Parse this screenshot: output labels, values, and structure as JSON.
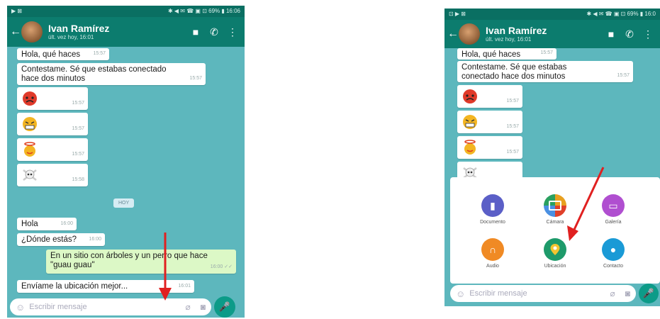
{
  "colors": {
    "header": "#0c7c6e",
    "chat_bg": "#5db7bd",
    "outgoing": "#dcf8c6",
    "arrow": "#e02020"
  },
  "phone1": {
    "status": {
      "left": "▶ ⊠",
      "right": "✱ ◀ ✉ ☎ ▣ ⊡ 69% ▮ 16:06"
    },
    "contact": {
      "name": "Ivan Ramírez",
      "status": "últ. vez hoy, 16:01"
    },
    "messages": [
      {
        "text": "Hola, qué haces",
        "time": "15:57"
      },
      {
        "text": "Contestame. Sé que estabas conectado hace dos minutos",
        "time": "15:57"
      },
      {
        "emoji": "angry-face",
        "time": "15:57"
      },
      {
        "emoji": "grimacing-face",
        "time": "15:57"
      },
      {
        "emoji": "angel-face",
        "time": "15:57"
      },
      {
        "emoji": "skull-crossbones",
        "time": "15:58"
      }
    ],
    "date_chip": "HOY",
    "messages2": [
      {
        "text": "Hola",
        "time": "16:00"
      },
      {
        "text": "¿Dónde estás?",
        "time": "16:00"
      },
      {
        "text": "En un sitio con árboles y un perro que hace \"guau guau\"",
        "time": "16:00 ✓✓",
        "out": true
      },
      {
        "text": "Envíame la ubicación mejor...",
        "time": "16:01"
      }
    ],
    "input_placeholder": "Escribir mensaje"
  },
  "phone2": {
    "status": {
      "left": "⊡ ▶ ⊠",
      "right": "✱ ◀ ✉ ☎ ▣ ⊡ 69% ▮ 16:0"
    },
    "contact": {
      "name": "Ivan Ramírez",
      "status": "últ. vez hoy, 16:01"
    },
    "messages": [
      {
        "text": "Hola, qué haces",
        "time": "15:57"
      },
      {
        "text": "Contestame. Sé que estabas conectado hace dos minutos",
        "time": "15:57"
      },
      {
        "emoji": "angry-face",
        "time": "15:57"
      },
      {
        "emoji": "grimacing-face",
        "time": "15:57"
      },
      {
        "emoji": "angel-face",
        "time": "15:57"
      },
      {
        "emoji": "skull-crossbones",
        "time": ""
      }
    ],
    "attach": [
      {
        "label": "Documento",
        "icon": "document-icon",
        "color": "#5b5fc7"
      },
      {
        "label": "Cámara",
        "icon": "camera-icon",
        "color": "#e8a020"
      },
      {
        "label": "Galería",
        "icon": "gallery-icon",
        "color": "#b04fd0"
      },
      {
        "label": "Audio",
        "icon": "headphones-icon",
        "color": "#f08a24"
      },
      {
        "label": "Ubicación",
        "icon": "map-pin-icon",
        "color": "#1e9a6a"
      },
      {
        "label": "Contacto",
        "icon": "contact-icon",
        "color": "#1a9ad6"
      }
    ],
    "input_placeholder": "Escribir mensaje"
  }
}
